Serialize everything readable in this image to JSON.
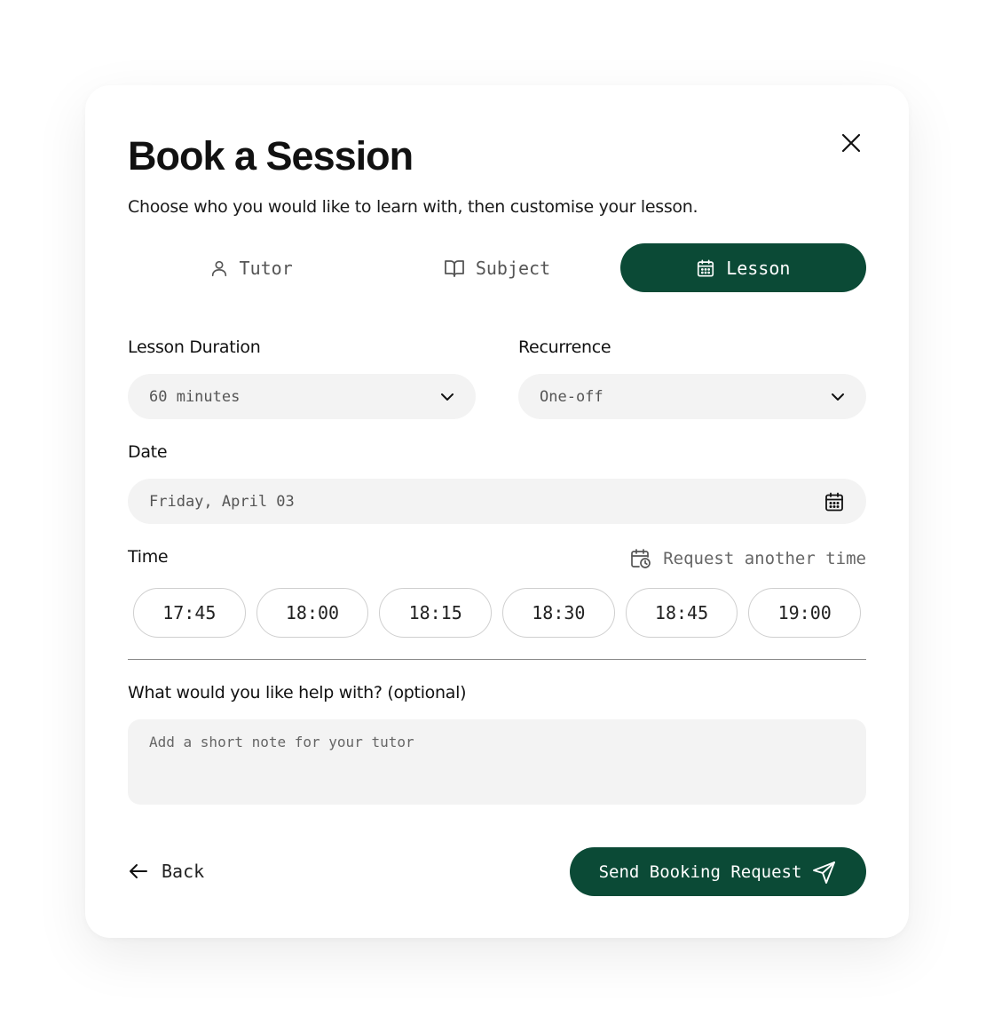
{
  "dialog": {
    "title": "Book a Session",
    "subtitle": "Choose who you would like to learn with, then customise your lesson."
  },
  "tabs": [
    {
      "label": "Tutor",
      "icon": "user-icon",
      "active": false
    },
    {
      "label": "Subject",
      "icon": "book-open-icon",
      "active": false
    },
    {
      "label": "Lesson",
      "icon": "calendar-icon",
      "active": true
    }
  ],
  "form": {
    "duration": {
      "label": "Lesson Duration",
      "value": "60 minutes"
    },
    "recurrence": {
      "label": "Recurrence",
      "value": "One-off"
    },
    "date": {
      "label": "Date",
      "value": "Friday, April 03"
    },
    "time": {
      "label": "Time",
      "request_label": "Request another time",
      "slots": [
        "17:45",
        "18:00",
        "18:15",
        "18:30",
        "18:45",
        "19:00"
      ]
    },
    "note": {
      "label": "What would you like help with? (optional)",
      "placeholder": "Add a short note for your tutor"
    }
  },
  "actions": {
    "back_label": "Back",
    "send_label": "Send Booking Request"
  },
  "colors": {
    "accent": "#0b4a36",
    "input_bg": "#f3f3f3",
    "slot_border": "#cfcfcf"
  }
}
